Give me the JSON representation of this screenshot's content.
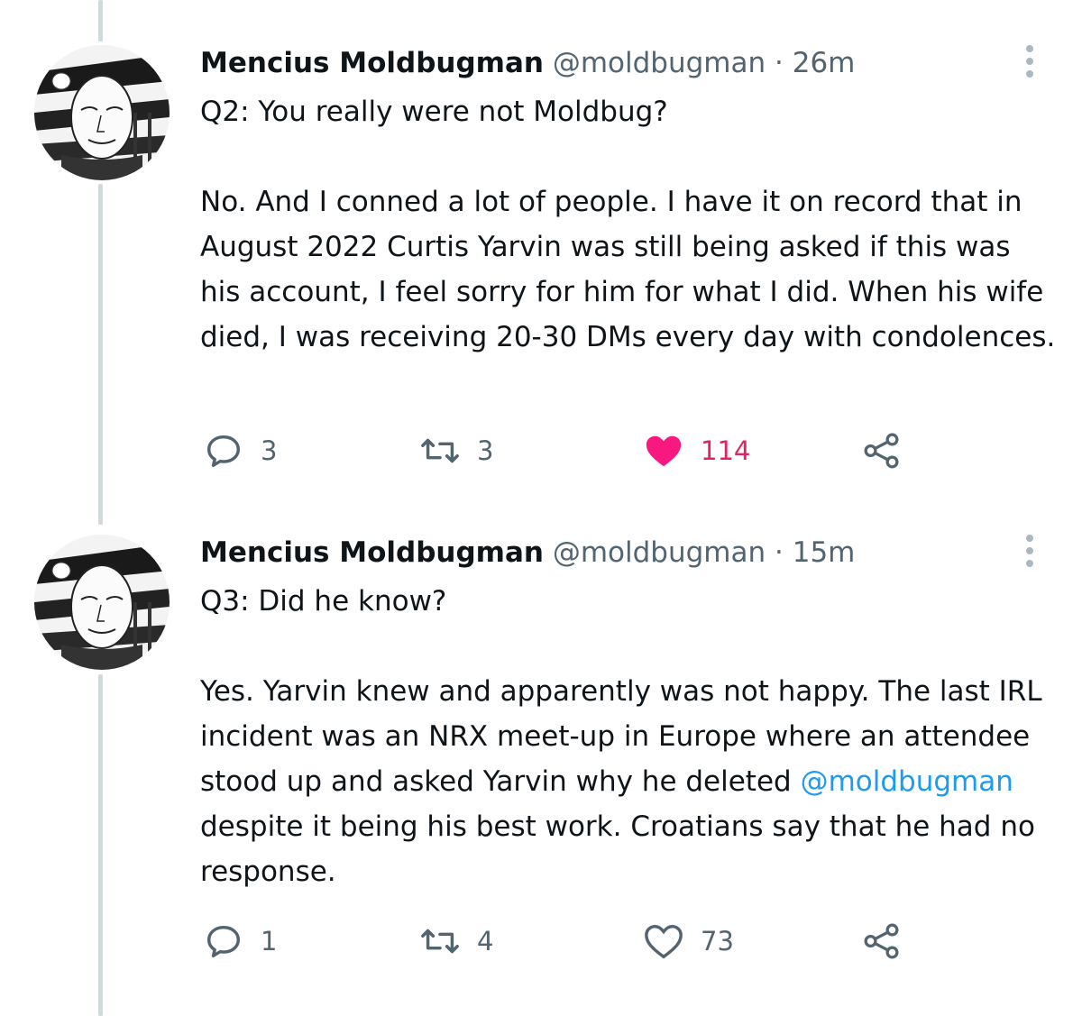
{
  "tweets": [
    {
      "author": {
        "name": "Mencius Moldbugman",
        "handle": "@moldbugman"
      },
      "separator": "·",
      "time": "26m",
      "text": {
        "q": "Q2: You really were not Moldbug?",
        "a1": "No. And I conned a lot of people. I have it on record that in August 2022 Curtis Yarvin was still being asked if this was his account, I feel sorry for him for what I did. When his wife died, I was receiving 20-30 DMs every day with condolences."
      },
      "actions": {
        "replies": "3",
        "retweets": "3",
        "likes": "114",
        "liked": true
      }
    },
    {
      "author": {
        "name": "Mencius Moldbugman",
        "handle": "@moldbugman"
      },
      "separator": "·",
      "time": "15m",
      "text": {
        "q": "Q3: Did he know?",
        "a1": "Yes. Yarvin knew and apparently was not happy. The last IRL incident was an NRX meet-up in Europe where an attendee stood up and asked Yarvin why he deleted ",
        "mention": "@moldbugman",
        "a2": " despite it being his best work. Croatians say that he had no response."
      },
      "actions": {
        "replies": "1",
        "retweets": "4",
        "likes": "73",
        "liked": false
      }
    }
  ],
  "colors": {
    "accent": "#1d9bf0",
    "like": "#f91880",
    "muted": "#536471",
    "text": "#0f1419"
  },
  "icons": [
    "avatar-portrait",
    "more-icon",
    "reply-icon",
    "retweet-icon",
    "heart-icon",
    "share-icon"
  ]
}
